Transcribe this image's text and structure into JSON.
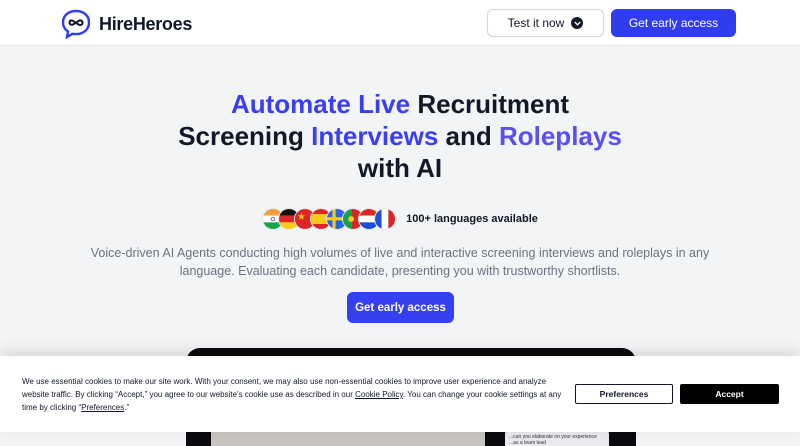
{
  "header": {
    "brand": "HireHeroes",
    "test_label": "Test it now",
    "cta_label": "Get early access"
  },
  "hero": {
    "line1_a": "Automate Live",
    "line1_b": " Recruitment",
    "line2_a": "Screening ",
    "line2_b": "Interviews",
    "line2_c": " and ",
    "line2_d": "Roleplays",
    "line3": "with AI",
    "languages": "100+ languages available",
    "subtitle": "Voice-driven AI Agents conducting high volumes of live and interactive screening interviews and roleplays in any language. Evaluating each candidate, presenting you with trustworthy shortlists.",
    "cta_label": "Get early access"
  },
  "flags": [
    "india-flag",
    "germany-flag",
    "china-flag",
    "spain-flag",
    "sweden-flag",
    "portugal-flag",
    "netherlands-flag",
    "france-flag"
  ],
  "video": {
    "chat_line1": "...can you elaborate on your experience",
    "chat_line2": "...as a team lead"
  },
  "cookie": {
    "text_1": "We use essential cookies to make our site work. With your consent, we may also use non-essential cookies to improve user experience and analyze website traffic. By clicking “Accept,” you agree to our website's cookie use as described in our ",
    "policy_link": "Cookie Policy",
    "text_2": ". You can change your cookie settings at any time by clicking “",
    "prefs_link": "Preferences",
    "text_3": ".”",
    "preferences_label": "Preferences",
    "accept_label": "Accept"
  },
  "colors": {
    "primary": "#2f3cf0",
    "highlight": "#3b3ff0",
    "highlight_alt": "#5b4ff4"
  }
}
